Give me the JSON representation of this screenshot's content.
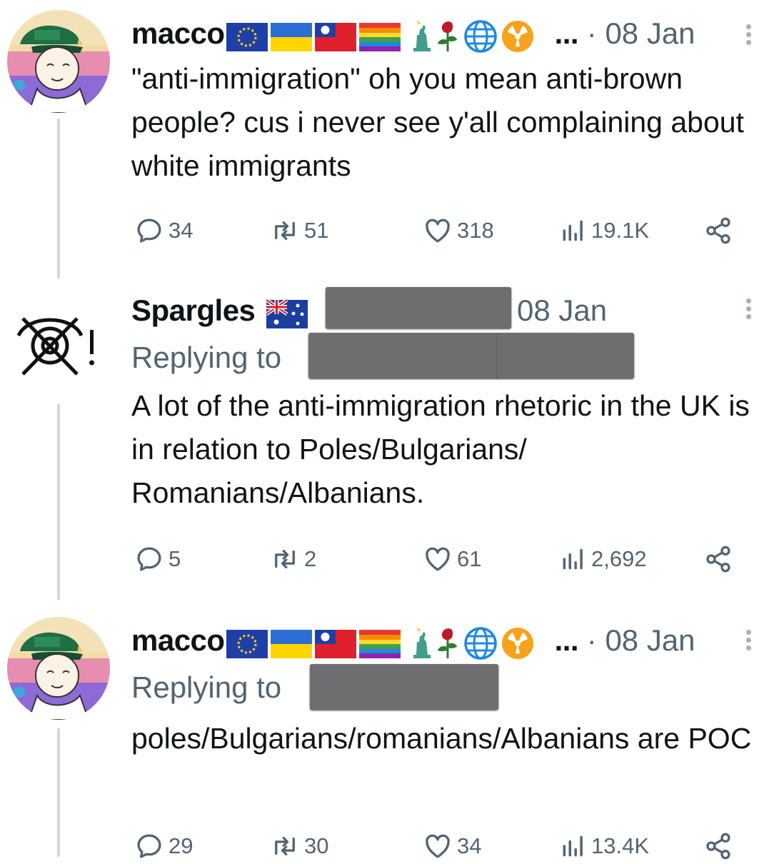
{
  "colors": {
    "text": "#0f1419",
    "muted": "#536471",
    "thread_line": "#cfd9de",
    "redaction": "#6e6e70"
  },
  "icons": [
    "reply-icon",
    "retweet-icon",
    "like-icon",
    "views-icon",
    "share-icon",
    "more-icon",
    "flag-eu",
    "flag-ukraine",
    "flag-taiwan",
    "flag-pride",
    "statue-of-liberty-icon",
    "rose-icon",
    "globe-icon",
    "radioactive-icon",
    "flag-australia"
  ],
  "tweets": [
    {
      "author": "macco",
      "emoji_overflow": "...",
      "separator": "·",
      "date": "08 Jan",
      "text": "\"anti-immigration\" oh you mean anti-brown people? cus i never see y'all complaining about white immigrants",
      "replies": "34",
      "retweets": "51",
      "likes": "318",
      "views": "19.1K"
    },
    {
      "author": "Spargles",
      "date": "08 Jan",
      "replying_to": "Replying to",
      "text": "A lot of the anti-immigration rhetoric in the UK is in relation to Poles/Bulgarians/ Romanians/Albanians.",
      "replies": "5",
      "retweets": "2",
      "likes": "61",
      "views": "2,692"
    },
    {
      "author": "macco",
      "emoji_overflow": "...",
      "separator": "·",
      "date": "08 Jan",
      "replying_to": "Replying to",
      "text": "poles/Bulgarians/romanians/Albanians are POC",
      "replies": "29",
      "retweets": "30",
      "likes": "34",
      "views": "13.4K"
    }
  ]
}
